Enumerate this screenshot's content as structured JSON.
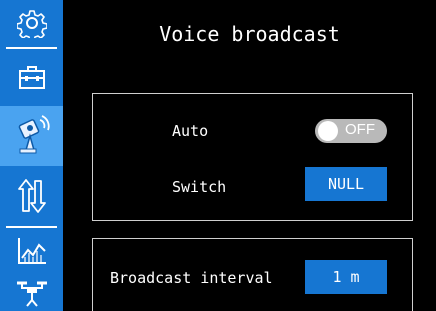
{
  "sidebar": {
    "items": [
      {
        "icon": "gear-icon"
      },
      {
        "icon": "toolbox-icon"
      },
      {
        "icon": "radio-controller-icon"
      },
      {
        "icon": "up-down-arrows-icon"
      },
      {
        "icon": "chart-icon"
      },
      {
        "icon": "drone-icon"
      }
    ],
    "active_index": 2
  },
  "page": {
    "title": "Voice broadcast"
  },
  "settings": {
    "auto_label": "Auto",
    "auto_toggle": {
      "state": "OFF",
      "enabled": false
    },
    "switch_label": "Switch",
    "switch_value": "NULL",
    "interval_label": "Broadcast interval",
    "interval_value": "1 m"
  },
  "colors": {
    "sidebar": "#1676d2",
    "sidebar_active": "#4aa3f0",
    "main_bg": "#000000",
    "accent": "#1676d2",
    "toggle_off": "#b9b9b9"
  }
}
